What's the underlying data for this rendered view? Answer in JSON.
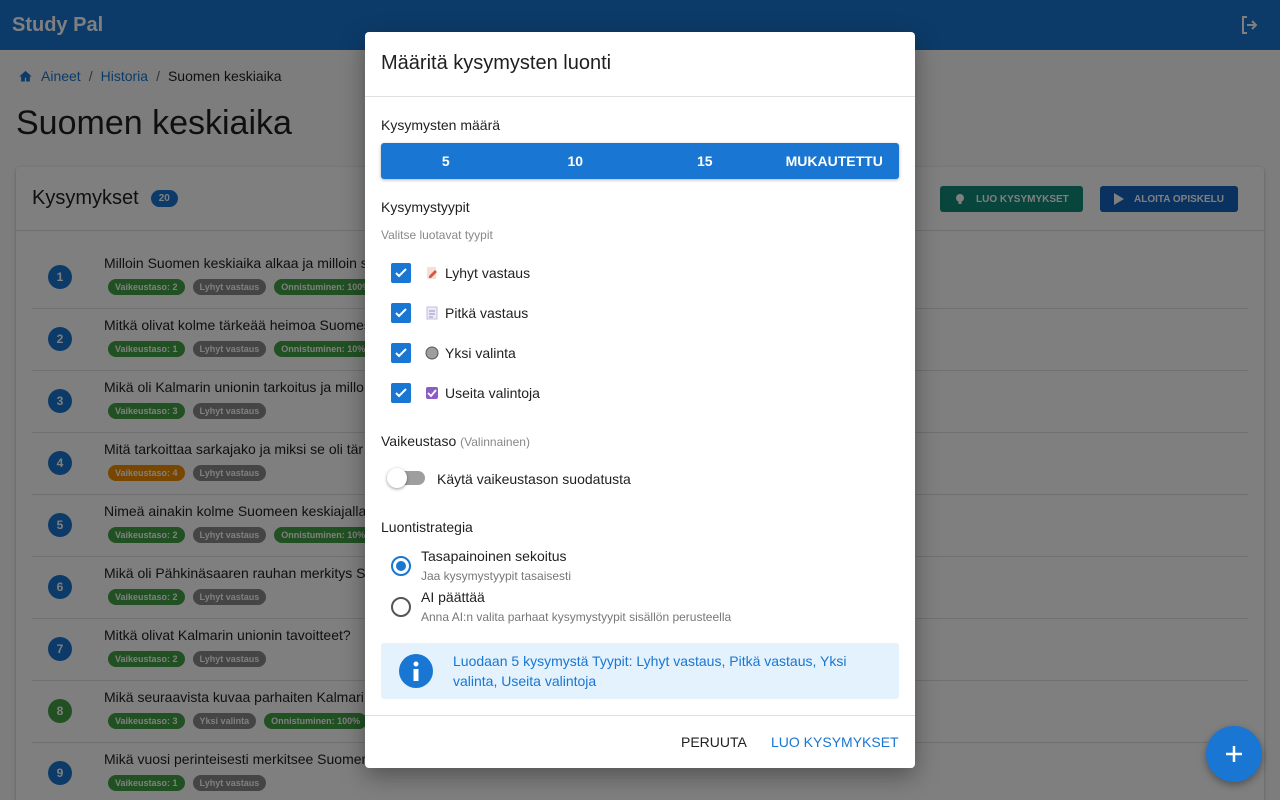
{
  "app": {
    "title": "Study Pal"
  },
  "breadcrumb": {
    "items": [
      "Aineet",
      "Historia"
    ],
    "current": "Suomen keskiaika",
    "separator": "/"
  },
  "page": {
    "title": "Suomen keskiaika"
  },
  "card": {
    "title": "Kysymykset",
    "count": "20",
    "create_button": "LUO KYSYMYKSET",
    "study_button": "ALOITA OPISKELU"
  },
  "questions": [
    {
      "num": "1",
      "text": "Milloin Suomen keskiaika alkaa ja milloin s",
      "num_color": "#1976d2",
      "chips": [
        {
          "label": "Vaikeustaso: 2",
          "cls": "chip-green"
        },
        {
          "label": "Lyhyt vastaus",
          "cls": "chip-grey"
        },
        {
          "label": "Onnistuminen: 100%",
          "cls": "chip-green"
        }
      ]
    },
    {
      "num": "2",
      "text": "Mitkä olivat kolme tärkeää heimoa Suomes",
      "num_color": "#1976d2",
      "chips": [
        {
          "label": "Vaikeustaso: 1",
          "cls": "chip-green"
        },
        {
          "label": "Lyhyt vastaus",
          "cls": "chip-grey"
        },
        {
          "label": "Onnistuminen: 10%",
          "cls": "chip-green"
        }
      ]
    },
    {
      "num": "3",
      "text": "Mikä oli Kalmarin unionin tarkoitus ja millo",
      "num_color": "#1976d2",
      "chips": [
        {
          "label": "Vaikeustaso: 3",
          "cls": "chip-green"
        },
        {
          "label": "Lyhyt vastaus",
          "cls": "chip-grey"
        }
      ]
    },
    {
      "num": "4",
      "text": "Mitä tarkoittaa sarkajako ja miksi se oli tär",
      "num_color": "#1976d2",
      "chips": [
        {
          "label": "Vaikeustaso: 4",
          "cls": "chip-orange"
        },
        {
          "label": "Lyhyt vastaus",
          "cls": "chip-grey"
        }
      ]
    },
    {
      "num": "5",
      "text": "Nimeä ainakin kolme Suomeen keskiajalla",
      "num_color": "#1976d2",
      "chips": [
        {
          "label": "Vaikeustaso: 2",
          "cls": "chip-green"
        },
        {
          "label": "Lyhyt vastaus",
          "cls": "chip-grey"
        },
        {
          "label": "Onnistuminen: 10%",
          "cls": "chip-green"
        }
      ]
    },
    {
      "num": "6",
      "text": "Mikä oli Pähkinäsaaren rauhan merkitys S",
      "num_color": "#1976d2",
      "chips": [
        {
          "label": "Vaikeustaso: 2",
          "cls": "chip-green"
        },
        {
          "label": "Lyhyt vastaus",
          "cls": "chip-grey"
        }
      ]
    },
    {
      "num": "7",
      "text": "Mitkä olivat Kalmarin unionin tavoitteet?",
      "num_color": "#1976d2",
      "chips": [
        {
          "label": "Vaikeustaso: 2",
          "cls": "chip-green"
        },
        {
          "label": "Lyhyt vastaus",
          "cls": "chip-grey"
        }
      ]
    },
    {
      "num": "8",
      "text": "Mikä seuraavista kuvaa parhaiten Kalmari",
      "num_color": "#43a047",
      "chips": [
        {
          "label": "Vaikeustaso: 3",
          "cls": "chip-green"
        },
        {
          "label": "Yksi valinta",
          "cls": "chip-grey"
        },
        {
          "label": "Onnistuminen: 100%",
          "cls": "chip-green"
        }
      ]
    },
    {
      "num": "9",
      "text": "Mikä vuosi perinteisesti merkitsee Suomer",
      "num_color": "#1976d2",
      "chips": [
        {
          "label": "Vaikeustaso: 1",
          "cls": "chip-green"
        },
        {
          "label": "Lyhyt vastaus",
          "cls": "chip-grey"
        }
      ]
    }
  ],
  "dialog": {
    "title": "Määritä kysymysten luonti",
    "count_label": "Kysymysten määrä",
    "count_options": [
      "5",
      "10",
      "15",
      "MUKAUTETTU"
    ],
    "types_label": "Kysymystyypit",
    "types_hint": "Valitse luotavat tyypit",
    "types": [
      {
        "label": "Lyhyt vastaus",
        "checked": true,
        "icon": "pencil-icon"
      },
      {
        "label": "Pitkä vastaus",
        "checked": true,
        "icon": "document-icon"
      },
      {
        "label": "Yksi valinta",
        "checked": true,
        "icon": "radio-dot-icon"
      },
      {
        "label": "Useita valintoja",
        "checked": true,
        "icon": "checkbox-icon"
      }
    ],
    "difficulty_label": "Vaikeustaso",
    "difficulty_optional": "(Valinnainen)",
    "difficulty_switch_label": "Käytä vaikeustason suodatusta",
    "difficulty_switch_on": false,
    "strategy_label": "Luontistrategia",
    "strategies": [
      {
        "title": "Tasapainoinen sekoitus",
        "desc": "Jaa kysymystyypit tasaisesti",
        "selected": true
      },
      {
        "title": "AI päättää",
        "desc": "Anna AI:n valita parhaat kysymystyypit sisällön perusteella",
        "selected": false
      }
    ],
    "info_text": "Luodaan 5 kysymystä Tyypit: Lyhyt vastaus, Pitkä vastaus, Yksi valinta, Useita valintoja",
    "cancel_label": "PERUUTA",
    "confirm_label": "LUO KYSYMYKSET"
  },
  "colors": {
    "primary": "#1976d2",
    "teal": "#0f8a7a",
    "green": "#43a047",
    "orange": "#f28c00"
  }
}
